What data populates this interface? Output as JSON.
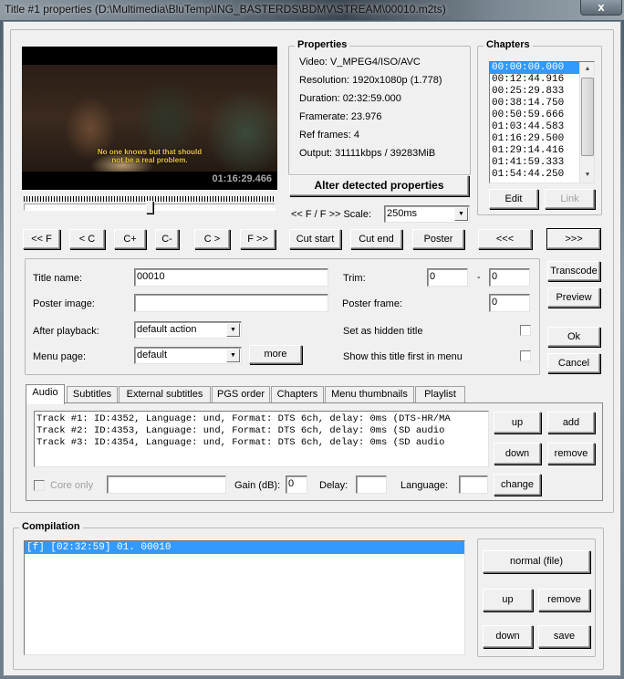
{
  "window": {
    "title": "Title #1 properties (D:\\Multimedia\\BluTemp\\ING_BASTERDS\\BDMV\\STREAM\\00010.m2ts)",
    "close_label": "x"
  },
  "preview": {
    "subtitle_line1": "No one knows but that should",
    "subtitle_line2": "not be a real problem.",
    "timecode": "01:16:29.466",
    "position_fraction": 0.5
  },
  "properties": {
    "legend": "Properties",
    "lines": [
      "Video: V_MPEG4/ISO/AVC",
      "Resolution: 1920x1080p (1.778)",
      "Duration: 02:32:59.000",
      "Framerate: 23.976",
      "Ref frames: 4",
      "Output: 31111kbps / 39283MiB"
    ],
    "alter_button": "Alter detected properties",
    "scale_label": "<< F / F >> Scale:",
    "scale_value": "250ms"
  },
  "chapters": {
    "legend": "Chapters",
    "items": [
      "00:00:00.000",
      "00:12:44.916",
      "00:25:29.833",
      "00:38:14.750",
      "00:50:59.666",
      "01:03:44.583",
      "01:16:29.500",
      "01:29:14.416",
      "01:41:59.333",
      "01:54:44.250"
    ],
    "selected_index": 0,
    "edit_button": "Edit",
    "link_button": "Link"
  },
  "nav_buttons": {
    "prev_frame": "<< F",
    "prev_chapter": "< C",
    "add_chapter": "C+",
    "remove_chapter": "C-",
    "next_chapter": "C >",
    "next_frame": "F >>",
    "cut_start": "Cut start",
    "cut_end": "Cut end",
    "poster": "Poster",
    "prev_title": "<<<",
    "next_title": ">>>"
  },
  "form": {
    "title_name_label": "Title name:",
    "title_name_value": "00010",
    "poster_image_label": "Poster image:",
    "poster_image_value": "",
    "after_playback_label": "After playback:",
    "after_playback_value": "default action",
    "menu_page_label": "Menu page:",
    "menu_page_value": "default",
    "more_button": "more",
    "trim_label": "Trim:",
    "trim_start": "0",
    "trim_separator": "-",
    "trim_end": "0",
    "poster_frame_label": "Poster frame:",
    "poster_frame_value": "0",
    "hidden_title_label": "Set as hidden title",
    "show_first_label": "Show this title first in menu"
  },
  "side_buttons": {
    "transcode": "Transcode",
    "preview": "Preview",
    "ok": "Ok",
    "cancel": "Cancel"
  },
  "tabs": [
    {
      "label": "Audio",
      "active": true
    },
    {
      "label": "Subtitles",
      "active": false
    },
    {
      "label": "External subtitles",
      "active": false
    },
    {
      "label": "PGS order",
      "active": false
    },
    {
      "label": "Chapters",
      "active": false
    },
    {
      "label": "Menu thumbnails",
      "active": false
    },
    {
      "label": "Playlist",
      "active": false
    }
  ],
  "audio": {
    "tracks": [
      "Track #1: ID:4352, Language: und, Format: DTS 6ch, delay: 0ms (DTS-HR/MA",
      "Track #2: ID:4353, Language: und, Format: DTS 6ch, delay: 0ms (SD audio",
      "Track #3: ID:4354, Language: und, Format: DTS 6ch, delay: 0ms (SD audio"
    ],
    "up_button": "up",
    "add_button": "add",
    "down_button": "down",
    "remove_button": "remove",
    "core_only_label": "Core only",
    "name_value": "",
    "gain_label": "Gain (dB):",
    "gain_value": "0",
    "delay_label": "Delay:",
    "delay_value": "",
    "language_label": "Language:",
    "language_value": "",
    "change_button": "change"
  },
  "compilation": {
    "legend": "Compilation",
    "items": [
      "[f] [02:32:59] 01. 00010"
    ],
    "selected_index": 0,
    "mode_button": "normal (file)",
    "up_button": "up",
    "remove_button": "remove",
    "down_button": "down",
    "save_button": "save"
  }
}
